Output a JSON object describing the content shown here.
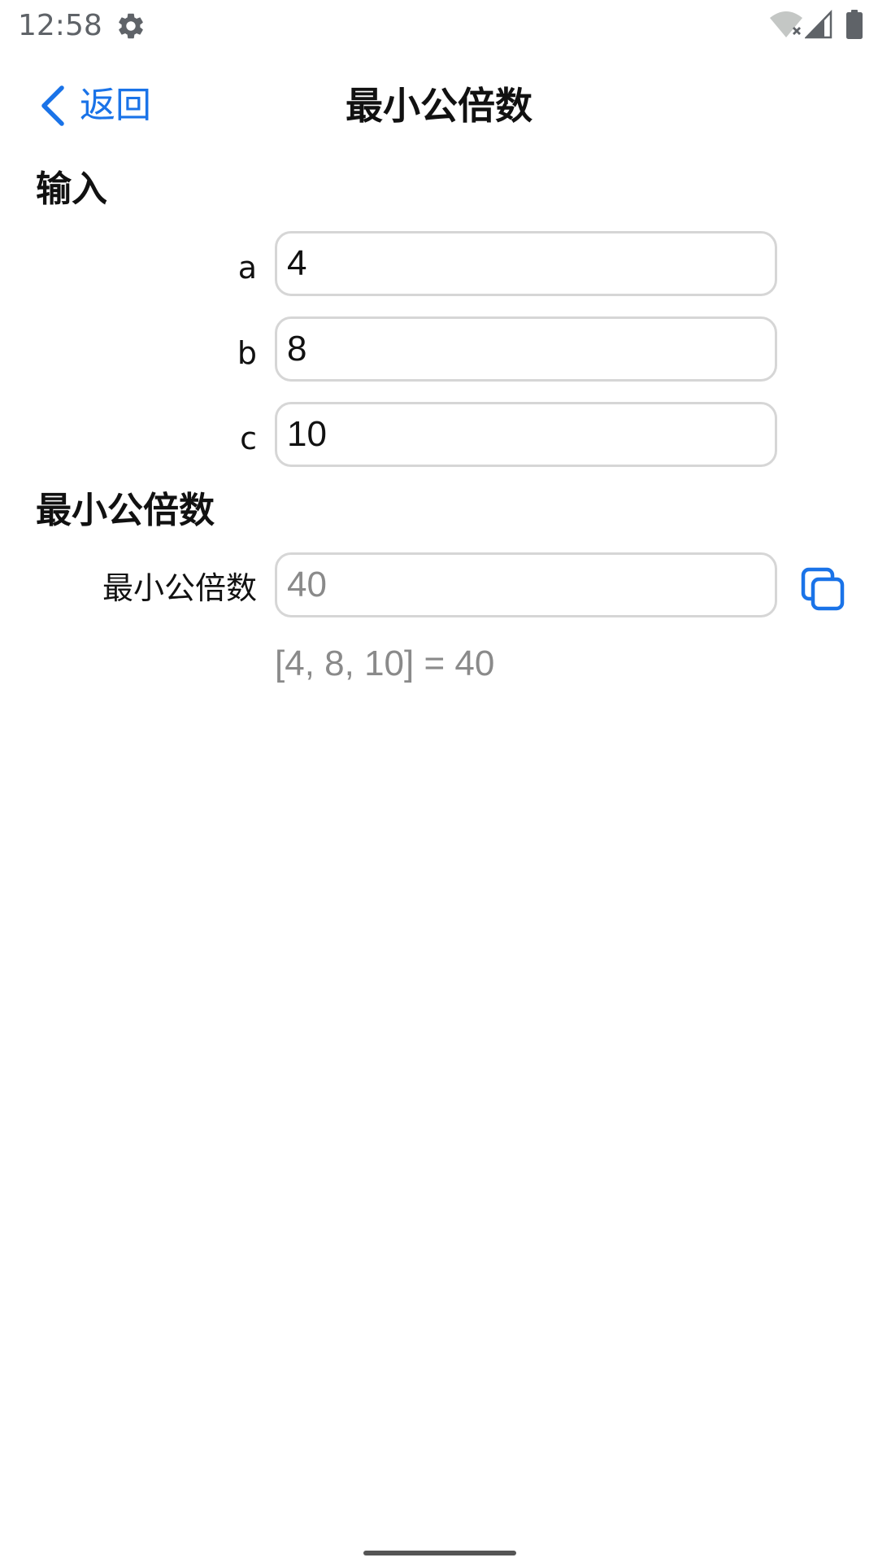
{
  "status_bar": {
    "time": "12:58",
    "icons": [
      "gear-icon",
      "wifi-off-icon",
      "signal-icon",
      "battery-icon"
    ]
  },
  "nav": {
    "back_label": "返回",
    "title": "最小公倍数"
  },
  "input_section": {
    "title": "输入",
    "fields": [
      {
        "label": "a",
        "value": "4"
      },
      {
        "label": "b",
        "value": "8"
      },
      {
        "label": "c",
        "value": "10"
      }
    ]
  },
  "result_section": {
    "title": "最小公倍数",
    "field_label": "最小公倍数",
    "value": "40",
    "formula": "[4, 8, 10] = 40"
  },
  "colors": {
    "accent": "#1a73e8",
    "border": "#d6d6d6",
    "muted_text": "#8a8a8a",
    "status_icon": "#5f6368"
  }
}
